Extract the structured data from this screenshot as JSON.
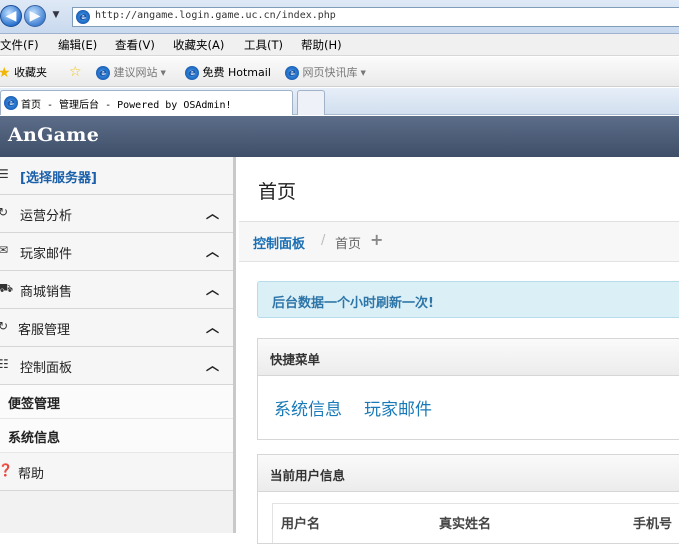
{
  "browser": {
    "address_url": "http://angame.login.game.uc.cn/index.php",
    "menu": [
      "文件(F)",
      "编辑(E)",
      "查看(V)",
      "收藏夹(A)",
      "工具(T)",
      "帮助(H)"
    ],
    "favorites": {
      "label": "收藏夹",
      "items": [
        "建议网站",
        "免费 Hotmail",
        "网页快讯库"
      ]
    },
    "tab_title": "首页 - 管理后台 - Powered by OSAdmin!"
  },
  "app": {
    "brand": "AnGame"
  },
  "sidebar": {
    "server": "[选择服务器]",
    "sections": [
      {
        "label": "运营分析",
        "icon": "refresh-icon"
      },
      {
        "label": "玩家邮件",
        "icon": "mail-icon"
      },
      {
        "label": "商城销售",
        "icon": "cart-icon"
      },
      {
        "label": "客服管理",
        "icon": "refresh-icon"
      },
      {
        "label": "控制面板",
        "icon": "list-icon"
      }
    ],
    "sub_items": [
      "便签管理",
      "系统信息"
    ],
    "help": "帮助"
  },
  "main": {
    "title": "首页",
    "breadcrumb": {
      "home": "控制面板",
      "sep": "/",
      "current": "首页",
      "plus": "+"
    },
    "alert": "后台数据一个小时刷新一次!",
    "quick_menu": {
      "title": "快捷菜单",
      "links": [
        "系统信息",
        "玩家邮件"
      ]
    },
    "user_info": {
      "title": "当前用户信息",
      "columns": [
        "用户名",
        "真实姓名",
        "手机号"
      ]
    }
  }
}
